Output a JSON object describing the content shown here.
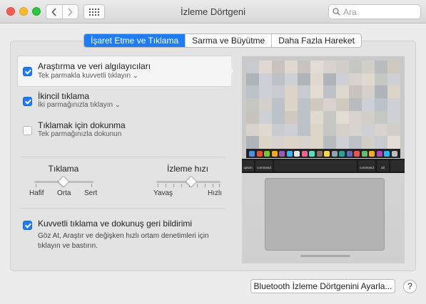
{
  "window": {
    "title": "İzleme Dörtgeni",
    "search_placeholder": "Ara"
  },
  "tabs": [
    {
      "label": "İşaret Etme ve Tıklama",
      "active": true
    },
    {
      "label": "Sarma ve Büyütme",
      "active": false
    },
    {
      "label": "Daha Fazla Hareket",
      "active": false
    }
  ],
  "options": {
    "lookup": {
      "title": "Araştırma ve veri algılayıcıları",
      "subtitle": "Tek parmakla kuvvetli tıklayın",
      "checked": true
    },
    "secondary": {
      "title": "İkincil tıklama",
      "subtitle": "İki parmağınızla tıklayın",
      "checked": true
    },
    "tap": {
      "title": "Tıklamak için dokunma",
      "subtitle": "Tek parmağınızla dokunun",
      "checked": false
    }
  },
  "sliders": {
    "click": {
      "title": "Tıklama",
      "labels": [
        "Hafif",
        "Orta",
        "Sert"
      ],
      "value": "Orta"
    },
    "speed": {
      "title": "İzleme hızı",
      "labels": [
        "Yavaş",
        "Hızlı"
      ],
      "level": 0.5
    }
  },
  "force_click": {
    "title": "Kuvvetli tıklama ve dokunuş geri bildirimi",
    "description": "Göz At, Araştır ve değişken hızlı ortam denetimleri için tıklayın ve bastırın.",
    "checked": true
  },
  "preview": {
    "keys": {
      "option": "option",
      "command": "command",
      "alt": "alt"
    }
  },
  "buttons": {
    "bluetooth": "Bluetooth İzleme Dörtgenini Ayarla...",
    "help": "?"
  },
  "colors": {
    "accent": "#1f7cf2"
  }
}
